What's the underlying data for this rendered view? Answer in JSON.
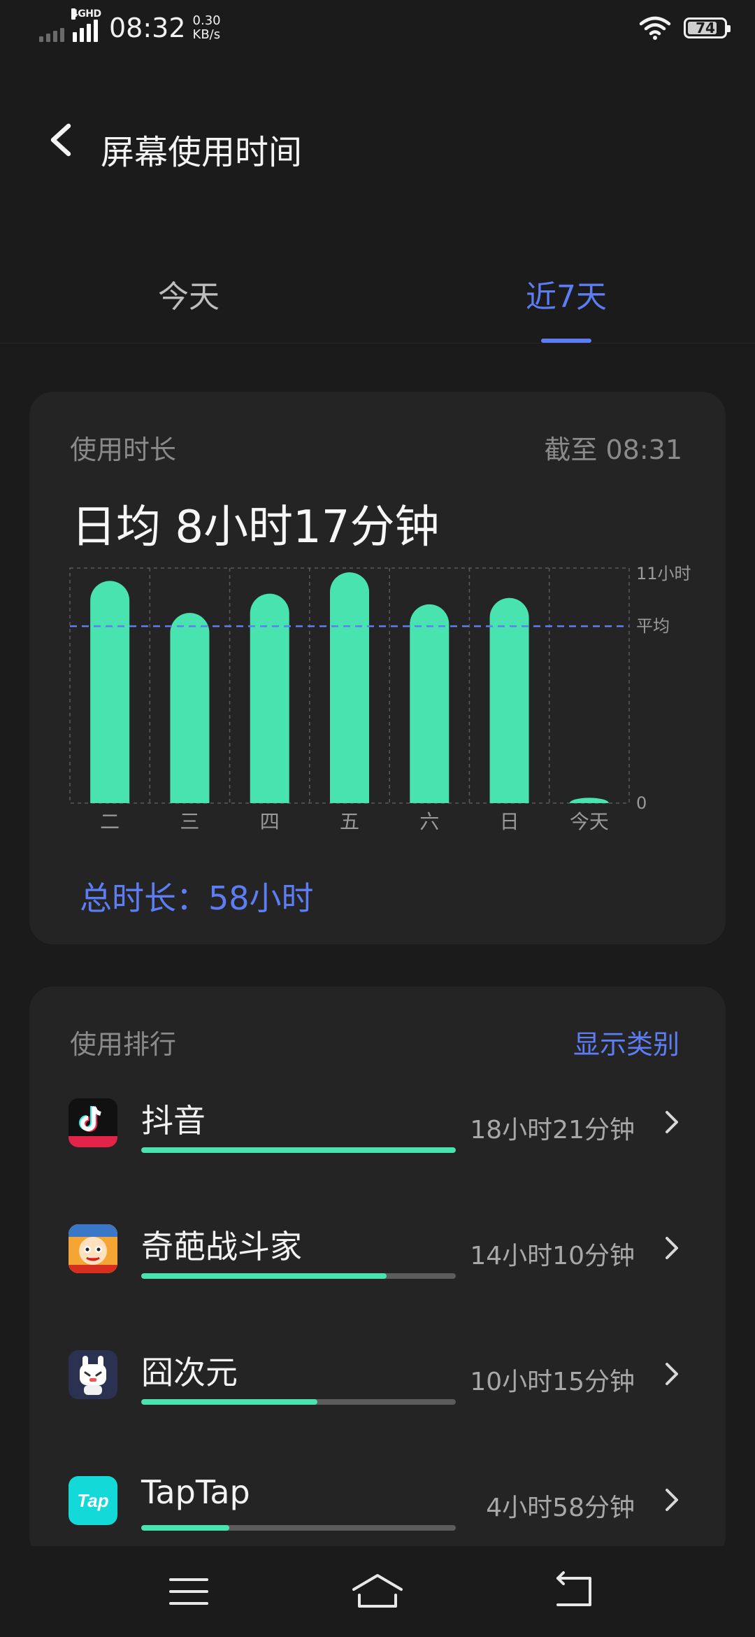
{
  "status_bar": {
    "network_type": "4GHD",
    "time": "08:32",
    "speed_value": "0.30",
    "speed_unit": "KB/s",
    "battery": "74",
    "icons": [
      "cellular-signal-icon",
      "wifi-icon",
      "battery-icon"
    ]
  },
  "header": {
    "title": "屏幕使用时间",
    "back_icon": "chevron-left-icon"
  },
  "tabs": [
    {
      "label": "今天",
      "selected": false
    },
    {
      "label": "近7天",
      "selected": true
    }
  ],
  "usage_card": {
    "label": "使用时长",
    "as_of": "截至 08:31",
    "daily_average": "日均 8小时17分钟",
    "total_label": "总时长：",
    "total_value": "58小时"
  },
  "chart_data": {
    "type": "bar",
    "categories": [
      "二",
      "三",
      "四",
      "五",
      "六",
      "日",
      "今天"
    ],
    "values": [
      10.4,
      8.9,
      9.8,
      10.8,
      9.3,
      9.6,
      0.25
    ],
    "ylim": [
      0,
      11
    ],
    "y_tick_labels": [
      "11小时",
      "0"
    ],
    "average": 8.28,
    "average_label": "平均",
    "grid": true,
    "bar_color": "#49e3b0",
    "average_line_color": "#5d7df5"
  },
  "ranking_card": {
    "label": "使用排行",
    "toggle_label": "显示类别",
    "apps": [
      {
        "name": "抖音",
        "time": "18小时21分钟",
        "share": 1.0,
        "icon": "douyin-app-icon"
      },
      {
        "name": "奇葩战斗家",
        "time": "14小时10分钟",
        "share": 0.78,
        "icon": "qipa-fighter-app-icon"
      },
      {
        "name": "囧次元",
        "time": "10小时15分钟",
        "share": 0.56,
        "icon": "jiongciyuan-app-icon"
      },
      {
        "name": "TapTap",
        "time": "4小时58分钟",
        "share": 0.28,
        "icon": "taptap-app-icon",
        "icon_text": "Tap"
      }
    ]
  },
  "nav_bar": {
    "icons": [
      "menu-icon",
      "home-icon",
      "back-icon"
    ]
  },
  "colors": {
    "background": "#1b1b1b",
    "card": "#242424",
    "accent_blue": "#5d7df5",
    "accent_green": "#49e3b0"
  }
}
